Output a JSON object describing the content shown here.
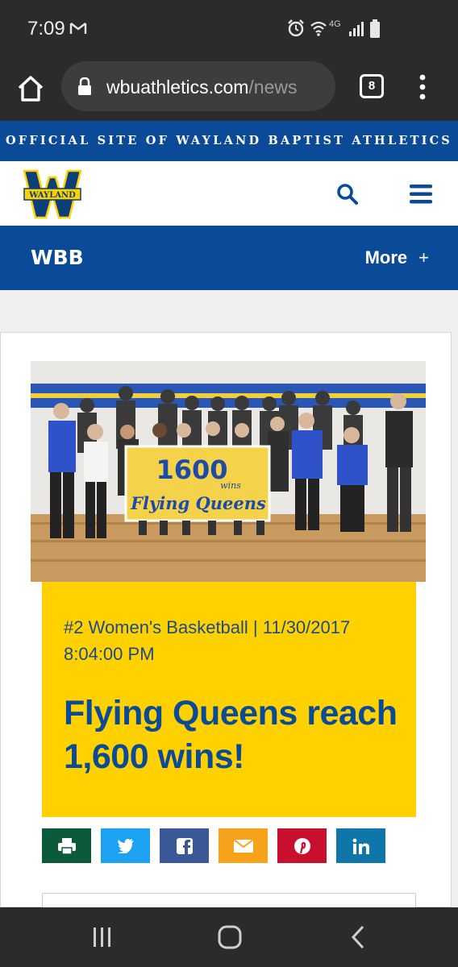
{
  "status_bar": {
    "time": "7:09",
    "network": "4G"
  },
  "browser": {
    "url_domain": "wbuathletics.com",
    "url_path": "/news",
    "tab_count": "8"
  },
  "site": {
    "banner": "OFFICIAL SITE OF WAYLAND BAPTIST ATHLETICS",
    "logo_text": "WAYLAND",
    "section_title": "WBB",
    "more_label": "More",
    "more_symbol": "+"
  },
  "photo": {
    "banner_number": "1600",
    "banner_small": "wins",
    "banner_script": "Flying Queens"
  },
  "article": {
    "meta": "#2 Women's Basketball | 11/30/2017 8:04:00 PM",
    "headline": "Flying Queens reach 1,600 wins!"
  },
  "share": [
    {
      "icon": "print-icon",
      "color": "#0b5a3c"
    },
    {
      "icon": "twitter-icon",
      "color": "#1da1f2"
    },
    {
      "icon": "facebook-icon",
      "color": "#3b5998"
    },
    {
      "icon": "email-icon",
      "color": "#f7a21b"
    },
    {
      "icon": "pinterest-icon",
      "color": "#c8102e"
    },
    {
      "icon": "linkedin-icon",
      "color": "#0e76a8"
    }
  ],
  "colors": {
    "brand_blue": "#0a4a96",
    "brand_gold": "#ffd100"
  }
}
